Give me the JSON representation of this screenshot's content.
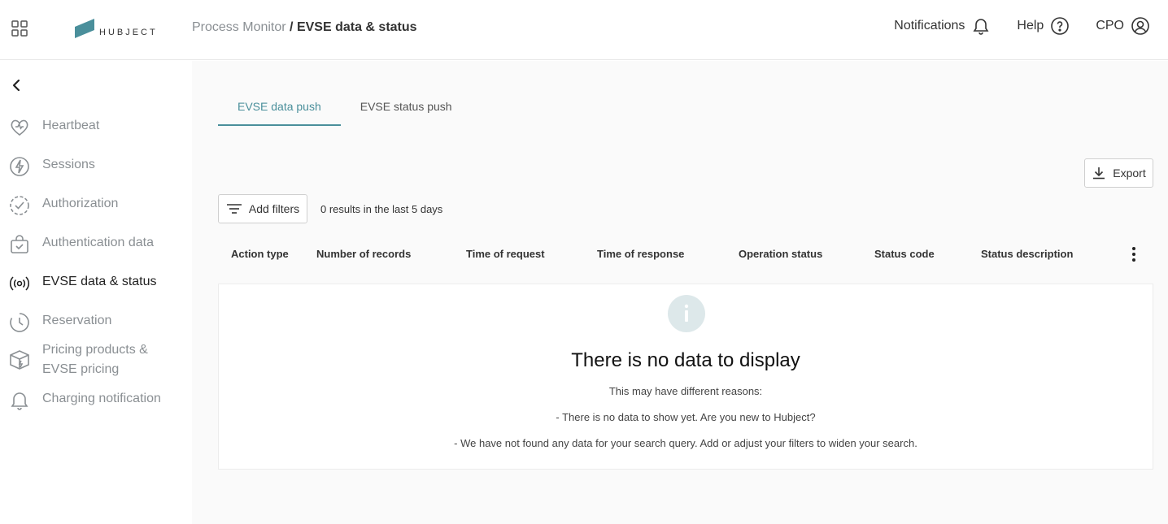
{
  "header": {
    "logo_text": "HUBJECT",
    "breadcrumb": {
      "parent": "Process Monitor",
      "separator": " / ",
      "current": "EVSE data & status"
    },
    "notifications_label": "Notifications",
    "help_label": "Help",
    "role_label": "CPO"
  },
  "sidebar": {
    "items": [
      {
        "label": "Heartbeat",
        "icon": "heart-icon"
      },
      {
        "label": "Sessions",
        "icon": "lightning-icon"
      },
      {
        "label": "Authorization",
        "icon": "check-circle-icon"
      },
      {
        "label": "Authentication data",
        "icon": "bag-check-icon"
      },
      {
        "label": "EVSE data & status",
        "icon": "broadcast-icon"
      },
      {
        "label": "Reservation",
        "icon": "clock-icon"
      },
      {
        "label": "Pricing products & EVSE pricing",
        "icon": "box-icon"
      },
      {
        "label": "Charging notification",
        "icon": "bell-icon"
      }
    ]
  },
  "tabs": [
    {
      "label": "EVSE data push",
      "active": true
    },
    {
      "label": "EVSE status push",
      "active": false
    }
  ],
  "toolbar": {
    "export_label": "Export",
    "filters_label": "Add filters",
    "results_text": "0 results in the last 5 days"
  },
  "table": {
    "columns": [
      "Action type",
      "Number of records",
      "Time of request",
      "Time of response",
      "Operation status",
      "Status code",
      "Status description"
    ]
  },
  "empty_state": {
    "title": "There is no data to display",
    "line1": "This may have different reasons:",
    "line2": "- There is no data to show yet. Are you new to Hubject?",
    "line3": "- We have not found any data for your search query. Add or adjust your filters to widen your search."
  },
  "colors": {
    "accent": "#4a8f9b",
    "logo": "#4a8f9b",
    "muted_text": "#8a8f93",
    "info_circle": "#dde8ea"
  }
}
